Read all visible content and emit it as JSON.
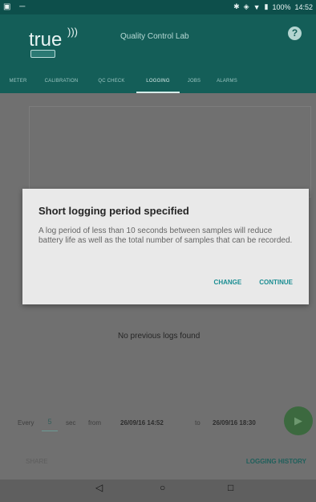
{
  "status": {
    "left": "▣ ─",
    "battery": "100%",
    "time": "14:52"
  },
  "app": {
    "logo_text": "true",
    "title": "Quality Control Lab",
    "help_icon": "?"
  },
  "tabs": [
    "METER",
    "CALIBRATION",
    "QC CHECK",
    "LOGGING",
    "JOBS",
    "ALARMS"
  ],
  "active_tab_index": 3,
  "main": {
    "empty_message": "No previous logs found",
    "controls": {
      "every_label": "Every",
      "period_value": "5",
      "unit": "sec",
      "from_label": "from",
      "from_value": "26/09/16 14:52",
      "to_label": "to",
      "to_value": "26/09/16 18:30"
    },
    "share": "SHARE",
    "history": "LOGGING HISTORY"
  },
  "dialog": {
    "title": "Short logging period specified",
    "message": "A log period of less than 10 seconds between samples will reduce battery life as well as the total number of samples that can be recorded.",
    "change": "CHANGE",
    "continue": "CONTINUE"
  },
  "nav": {
    "back": "◁",
    "home": "○",
    "recent": "□"
  },
  "colors": {
    "primary": "#145e58",
    "accent": "#1a8d92",
    "overlay": "#707070"
  }
}
